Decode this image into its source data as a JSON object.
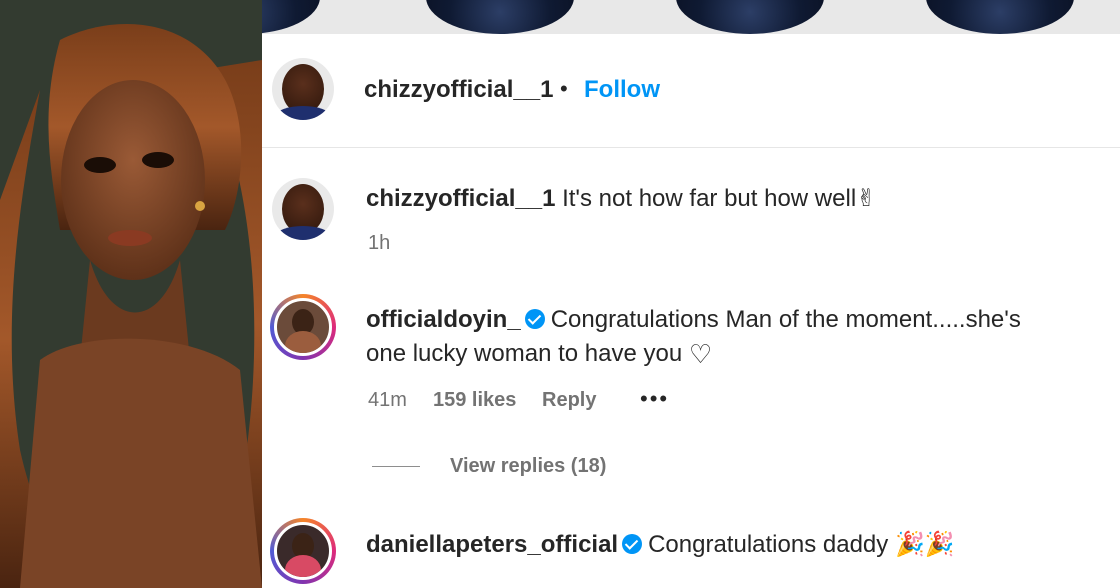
{
  "header": {
    "username": "chizzyofficial__1",
    "separator": "•",
    "follow_label": "Follow"
  },
  "comments": [
    {
      "username": "chizzyofficial__1",
      "text": " It's not how far but how well",
      "emoji": "✌",
      "time": "1h"
    },
    {
      "username": "officialdoyin_",
      "verified": true,
      "text_line1": "Congratulations Man of the moment.....she's",
      "text_line2": "one lucky woman to have you",
      "emoji": "♡",
      "time": "41m",
      "likes": "159 likes",
      "reply_label": "Reply",
      "more": "•••",
      "view_replies": "View replies (18)"
    },
    {
      "username": "daniellapeters_official",
      "verified": true,
      "text": "Congratulations daddy",
      "emoji": "🎉🎉"
    }
  ],
  "colors": {
    "link_blue": "#0095f6",
    "text": "#262626",
    "muted": "#737373"
  }
}
